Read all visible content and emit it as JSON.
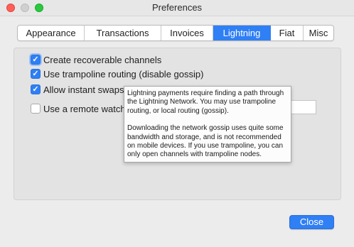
{
  "window": {
    "title": "Preferences",
    "buttons": [
      "close-button",
      "minimize-button",
      "zoom-button"
    ]
  },
  "tabs": [
    {
      "label": "Appearance",
      "active": false
    },
    {
      "label": "Transactions",
      "active": false
    },
    {
      "label": "Invoices",
      "active": false
    },
    {
      "label": "Lightning",
      "active": true
    },
    {
      "label": "Fiat",
      "active": false
    },
    {
      "label": "Misc",
      "active": false
    }
  ],
  "options": [
    {
      "label": "Create recoverable channels",
      "checked": true
    },
    {
      "label": "Use trampoline routing (disable gossip)",
      "checked": true
    },
    {
      "label": "Allow instant swaps",
      "checked": true
    },
    {
      "label": "Use a remote watchtower",
      "checked": false
    }
  ],
  "watchtower": {
    "value": ""
  },
  "tooltip": {
    "paragraph1": "Lightning payments require finding a path through the Lightning Network. You may use trampoline routing, or local routing (gossip).",
    "paragraph2": "Downloading the network gossip uses quite some bandwidth and storage, and is not recommended on mobile devices. If you use trampoline, you can only open channels with trampoline nodes."
  },
  "footer": {
    "close_label": "Close"
  },
  "colors": {
    "accent": "#2f7ff5",
    "background": "#ececec"
  },
  "icons": {
    "checkmark": "checkmark-icon"
  }
}
